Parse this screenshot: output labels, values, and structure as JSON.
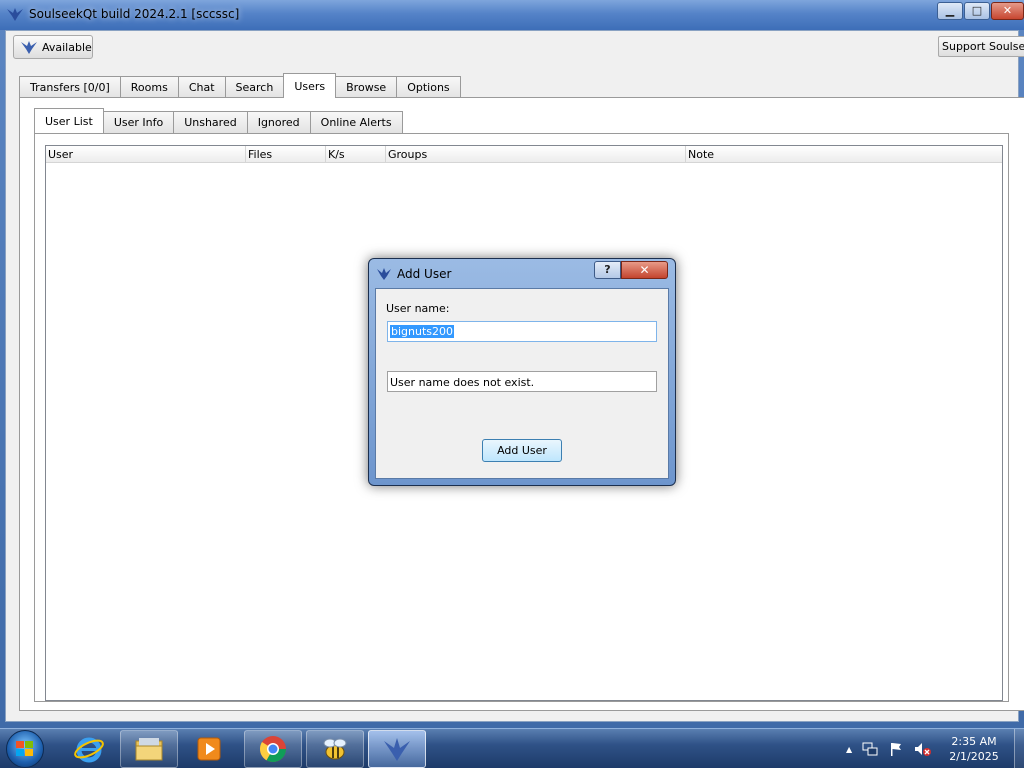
{
  "window": {
    "title": "SoulseekQt build 2024.2.1 [sccssc]",
    "controls": {
      "minimize": "▁",
      "maximize": "□",
      "close": "✕"
    }
  },
  "toolbar": {
    "status_label": "Available",
    "support_label": "Support Soulseek"
  },
  "main_tabs": [
    {
      "label": "Transfers [0/0]",
      "active": false
    },
    {
      "label": "Rooms",
      "active": false
    },
    {
      "label": "Chat",
      "active": false
    },
    {
      "label": "Search",
      "active": false
    },
    {
      "label": "Users",
      "active": true
    },
    {
      "label": "Browse",
      "active": false
    },
    {
      "label": "Options",
      "active": false
    }
  ],
  "sub_tabs": [
    {
      "label": "User List",
      "active": true
    },
    {
      "label": "User Info",
      "active": false
    },
    {
      "label": "Unshared",
      "active": false
    },
    {
      "label": "Ignored",
      "active": false
    },
    {
      "label": "Online Alerts",
      "active": false
    }
  ],
  "user_list": {
    "columns": [
      "User",
      "Files",
      "K/s",
      "Groups",
      "Note"
    ],
    "rows": []
  },
  "dialog": {
    "title": "Add User",
    "help": "?",
    "close": "✕",
    "field_label": "User name:",
    "username_value": "bignuts200",
    "message": "User name does not exist.",
    "button_label": "Add User"
  },
  "taskbar": {
    "items": [
      "internet-explorer",
      "file-explorer",
      "media-player",
      "chrome",
      "bee-app",
      "soulseek"
    ],
    "clock_time": "2:35 AM",
    "clock_date": "2/1/2025",
    "tray_chevron": "▲"
  },
  "colors": {
    "accent": "#3399ff",
    "titlebar": "#5583c8",
    "taskbar": "#2f5287"
  }
}
